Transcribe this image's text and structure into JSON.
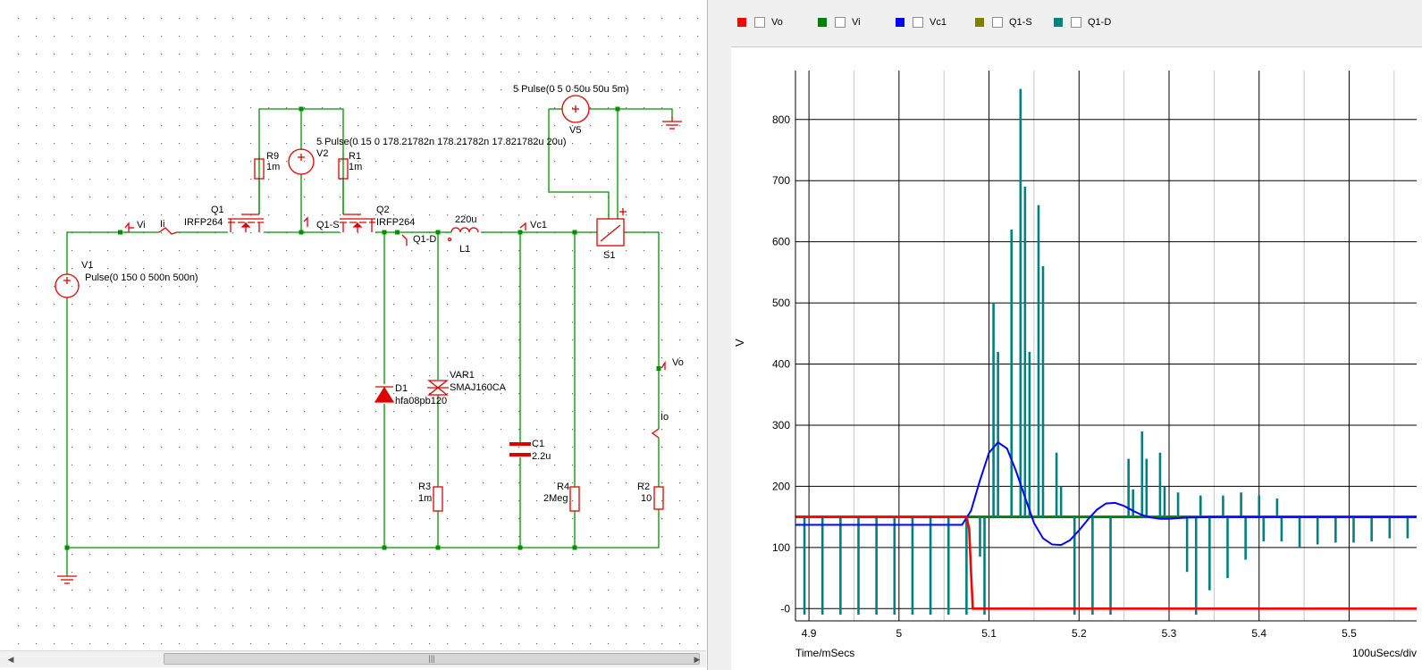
{
  "schematic": {
    "labels": {
      "v1_name": "V1",
      "v1_value": "Pulse(0 150 0 500n 500n)",
      "v2_name": "V2",
      "v2_value": "5 Pulse(0 15 0 178.21782n 178.21782n 17.821782u 20u)",
      "v5_name": "V5",
      "v5_value": "5 Pulse(0 5 0 50u 50u 5m)",
      "r9_name": "R9",
      "r9_value": "1m",
      "r1_name": "R1",
      "r1_value": "1m",
      "q1_name": "Q1",
      "q1_value": "IRFP264",
      "q2_name": "Q2",
      "q2_value": "IRFP264",
      "l1_name": "L1",
      "l1_value": "220u",
      "s1_name": "S1",
      "d1_name": "D1",
      "d1_value": "hfa08pb120",
      "var1_name": "VAR1",
      "var1_value": "SMAJ160CA",
      "c1_name": "C1",
      "c1_value": "2.2u",
      "r3_name": "R3",
      "r3_value": "1m",
      "r4_name": "R4",
      "r4_value": "2Meg",
      "r2_name": "R2",
      "r2_value": "10",
      "probe_vi": "Vi",
      "probe_ii": "Ii",
      "probe_q1s": "Q1-S",
      "probe_q1d": "Q1-D",
      "probe_vc1": "Vc1",
      "probe_vo": "Vo",
      "probe_io": "Io"
    }
  },
  "scrollbar": {
    "grip": "|||"
  },
  "legend": [
    {
      "label": "Vo",
      "color": "#ff0000",
      "checked": false
    },
    {
      "label": "Vi",
      "color": "#008000",
      "checked": false
    },
    {
      "label": "Vc1",
      "color": "#0000ff",
      "checked": false
    },
    {
      "label": "Q1-S",
      "color": "#808000",
      "checked": false
    },
    {
      "label": "Q1-D",
      "color": "#008080",
      "checked": false
    }
  ],
  "chart_data": {
    "type": "line",
    "xlabel": "Time/mSecs",
    "ylabel": "V",
    "x_scale_note": "100uSecs/div",
    "xlim": [
      4.885,
      5.575
    ],
    "ylim": [
      -20,
      880
    ],
    "x_ticks": [
      4.9,
      5,
      5.1,
      5.2,
      5.3,
      5.4,
      5.5
    ],
    "x_tick_labels": [
      "4.9",
      "5",
      "5.1",
      "5.2",
      "5.3",
      "5.4",
      "5.5"
    ],
    "y_ticks": [
      0,
      100,
      200,
      300,
      400,
      500,
      600,
      700,
      800
    ],
    "y_tick_labels": [
      "-0",
      "100",
      "200",
      "300",
      "400",
      "500",
      "600",
      "700",
      "800"
    ],
    "grid": true,
    "series": [
      {
        "name": "Vi",
        "color": "#008000",
        "points": [
          [
            4.885,
            150
          ],
          [
            5.575,
            150
          ]
        ]
      },
      {
        "name": "Vc1",
        "color": "#0000ff",
        "points": [
          [
            4.885,
            137
          ],
          [
            5.07,
            137
          ],
          [
            5.08,
            160
          ],
          [
            5.09,
            210
          ],
          [
            5.1,
            255
          ],
          [
            5.11,
            272
          ],
          [
            5.12,
            262
          ],
          [
            5.13,
            225
          ],
          [
            5.14,
            182
          ],
          [
            5.15,
            140
          ],
          [
            5.16,
            115
          ],
          [
            5.17,
            105
          ],
          [
            5.18,
            104
          ],
          [
            5.19,
            112
          ],
          [
            5.2,
            128
          ],
          [
            5.21,
            146
          ],
          [
            5.22,
            162
          ],
          [
            5.23,
            172
          ],
          [
            5.24,
            173
          ],
          [
            5.25,
            168
          ],
          [
            5.26,
            160
          ],
          [
            5.27,
            153
          ],
          [
            5.28,
            149
          ],
          [
            5.29,
            147
          ],
          [
            5.3,
            147
          ],
          [
            5.31,
            148
          ],
          [
            5.32,
            149
          ],
          [
            5.35,
            150
          ],
          [
            5.575,
            150
          ]
        ]
      },
      {
        "name": "Vo",
        "color": "#ff0000",
        "points": [
          [
            4.885,
            150
          ],
          [
            5.075,
            150
          ],
          [
            5.078,
            130
          ],
          [
            5.08,
            60
          ],
          [
            5.082,
            0
          ],
          [
            5.575,
            0
          ]
        ]
      },
      {
        "name": "Q1-D",
        "color": "#008080",
        "base": 150,
        "spikes": [
          [
            4.895,
            -10
          ],
          [
            4.915,
            -10
          ],
          [
            4.935,
            -10
          ],
          [
            4.955,
            -10
          ],
          [
            4.975,
            -10
          ],
          [
            4.995,
            -10
          ],
          [
            5.015,
            -10
          ],
          [
            5.035,
            -10
          ],
          [
            5.055,
            -10
          ],
          [
            5.075,
            -10
          ],
          [
            5.09,
            85
          ],
          [
            5.095,
            -10
          ],
          [
            5.105,
            500
          ],
          [
            5.11,
            420
          ],
          [
            5.125,
            620
          ],
          [
            5.135,
            850
          ],
          [
            5.14,
            690
          ],
          [
            5.145,
            420
          ],
          [
            5.155,
            660
          ],
          [
            5.16,
            560
          ],
          [
            5.175,
            255
          ],
          [
            5.18,
            200
          ],
          [
            5.195,
            -10
          ],
          [
            5.215,
            -10
          ],
          [
            5.235,
            -10
          ],
          [
            5.255,
            245
          ],
          [
            5.26,
            195
          ],
          [
            5.27,
            290
          ],
          [
            5.275,
            245
          ],
          [
            5.29,
            255
          ],
          [
            5.295,
            200
          ],
          [
            5.31,
            190
          ],
          [
            5.32,
            60
          ],
          [
            5.33,
            -10
          ],
          [
            5.335,
            185
          ],
          [
            5.345,
            30
          ],
          [
            5.36,
            185
          ],
          [
            5.365,
            50
          ],
          [
            5.38,
            190
          ],
          [
            5.385,
            80
          ],
          [
            5.4,
            185
          ],
          [
            5.405,
            110
          ],
          [
            5.42,
            180
          ],
          [
            5.425,
            110
          ],
          [
            5.44,
            150
          ],
          [
            5.445,
            100
          ],
          [
            5.46,
            150
          ],
          [
            5.465,
            105
          ],
          [
            5.48,
            150
          ],
          [
            5.485,
            108
          ],
          [
            5.5,
            150
          ],
          [
            5.505,
            108
          ],
          [
            5.52,
            150
          ],
          [
            5.525,
            110
          ],
          [
            5.54,
            150
          ],
          [
            5.545,
            115
          ],
          [
            5.56,
            150
          ],
          [
            5.565,
            115
          ]
        ]
      }
    ]
  }
}
